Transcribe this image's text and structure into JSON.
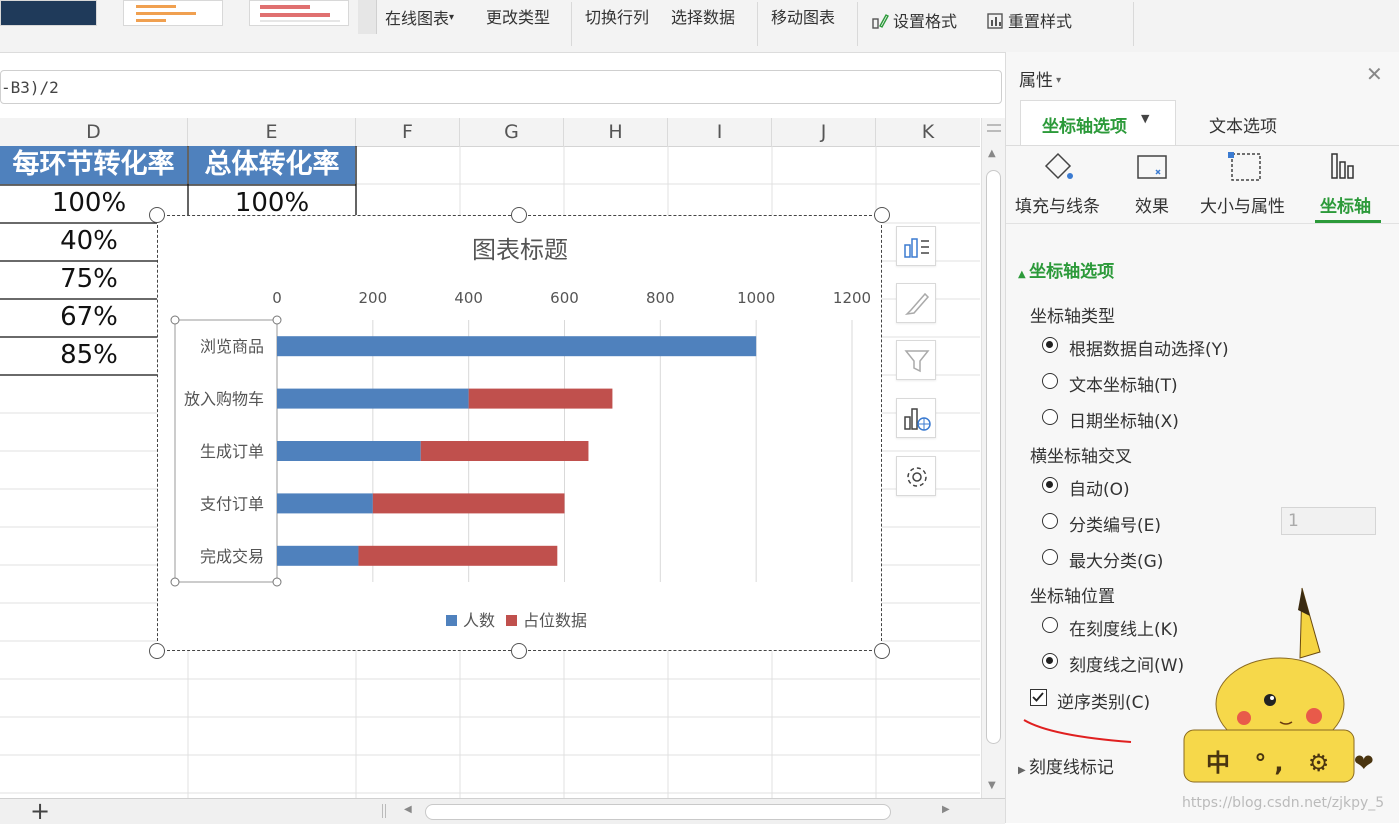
{
  "ribbon": {
    "online_chart": "在线图表",
    "change_type": "更改类型",
    "switch_row_col": "切换行列",
    "select_data": "选择数据",
    "move_chart": "移动图表",
    "set_format": "设置格式",
    "reset_style": "重置样式"
  },
  "formula": {
    "text": "-B3)/2"
  },
  "columns": [
    "D",
    "E",
    "F",
    "G",
    "H",
    "I",
    "J",
    "K"
  ],
  "table": {
    "header_d": "每环节转化率",
    "header_e": "总体转化率",
    "rows": [
      {
        "d": "100%",
        "e": "100%"
      },
      {
        "d": "40%"
      },
      {
        "d": "75%"
      },
      {
        "d": "67%"
      },
      {
        "d": "85%"
      }
    ]
  },
  "chart_data": {
    "type": "bar",
    "orientation": "horizontal",
    "stacked": true,
    "title": "图表标题",
    "categories": [
      "浏览商品",
      "放入购物车",
      "生成订单",
      "支付订单",
      "完成交易"
    ],
    "series": [
      {
        "name": "人数",
        "color": "#4f81bd",
        "values": [
          1000,
          400,
          300,
          200,
          170
        ]
      },
      {
        "name": "占位数据",
        "color": "#c0504d",
        "values": [
          0,
          300,
          350,
          400,
          415
        ]
      }
    ],
    "xlim": [
      0,
      1200
    ],
    "ticks": [
      "0",
      "200",
      "400",
      "600",
      "800",
      "1000",
      "1200"
    ],
    "tick_values": [
      0,
      200,
      400,
      600,
      800,
      1000,
      1200
    ],
    "axis_position": "top",
    "grid": true,
    "legend": "bottom"
  },
  "panel": {
    "title": "属性",
    "tab_axis_options": "坐标轴选项",
    "tab_text_options": "文本选项",
    "icon_tabs": [
      "填充与线条",
      "效果",
      "大小与属性",
      "坐标轴"
    ],
    "section_title": "坐标轴选项",
    "axis_type_label": "坐标轴类型",
    "axis_type_options": [
      "根据数据自动选择(Y)",
      "文本坐标轴(T)",
      "日期坐标轴(X)"
    ],
    "cross_label": "横坐标轴交叉",
    "cross_options": [
      "自动(O)",
      "分类编号(E)",
      "最大分类(G)"
    ],
    "cross_value": "1",
    "position_label": "坐标轴位置",
    "position_options": [
      "在刻度线上(K)",
      "刻度线之间(W)"
    ],
    "reverse_label": "逆序类别(C)",
    "tick_marks_label": "刻度线标记",
    "sticker_text": "中 °, ⚙ ❤"
  },
  "watermark": "https://blog.csdn.net/zjkpy_5",
  "colors": {
    "accent_green": "#2c9a3a",
    "header_blue": "#4f81bd",
    "series_red": "#c0504d"
  }
}
